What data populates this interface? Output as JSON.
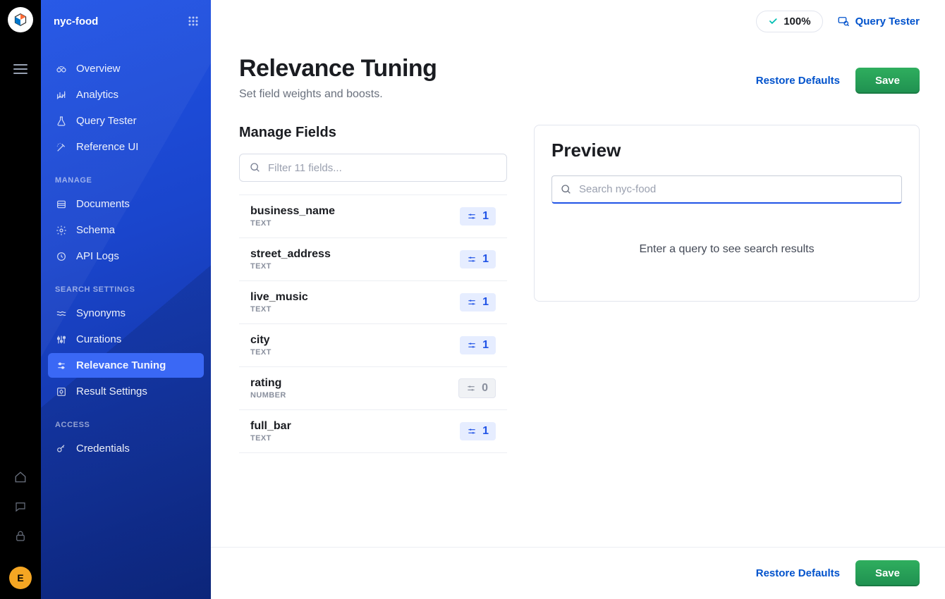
{
  "engine": {
    "name": "nyc-food"
  },
  "topbar": {
    "score_percent": "100%",
    "query_tester_label": "Query Tester"
  },
  "avatar": {
    "initial": "E"
  },
  "nav": {
    "top": [
      {
        "label": "Overview",
        "icon": "binoculars-icon"
      },
      {
        "label": "Analytics",
        "icon": "bars-trend-icon"
      },
      {
        "label": "Query Tester",
        "icon": "flask-icon"
      },
      {
        "label": "Reference UI",
        "icon": "magic-wand-icon"
      }
    ],
    "sections": [
      {
        "label": "MANAGE",
        "items": [
          {
            "label": "Documents",
            "icon": "list-icon"
          },
          {
            "label": "Schema",
            "icon": "gear-icon"
          },
          {
            "label": "API Logs",
            "icon": "clock-icon"
          }
        ]
      },
      {
        "label": "SEARCH SETTINGS",
        "items": [
          {
            "label": "Synonyms",
            "icon": "waves-icon"
          },
          {
            "label": "Curations",
            "icon": "levels-icon"
          },
          {
            "label": "Relevance Tuning",
            "icon": "sliders-icon",
            "active": true
          },
          {
            "label": "Result Settings",
            "icon": "settings-page-icon"
          }
        ]
      },
      {
        "label": "ACCESS",
        "items": [
          {
            "label": "Credentials",
            "icon": "key-icon"
          }
        ]
      }
    ]
  },
  "page": {
    "title": "Relevance Tuning",
    "subtitle": "Set field weights and boosts.",
    "restore_label": "Restore Defaults",
    "save_label": "Save"
  },
  "manage_fields": {
    "title": "Manage Fields",
    "filter_placeholder": "Filter 11 fields...",
    "fields": [
      {
        "name": "business_name",
        "type": "TEXT",
        "weight": "1",
        "muted": false
      },
      {
        "name": "street_address",
        "type": "TEXT",
        "weight": "1",
        "muted": false
      },
      {
        "name": "live_music",
        "type": "TEXT",
        "weight": "1",
        "muted": false
      },
      {
        "name": "city",
        "type": "TEXT",
        "weight": "1",
        "muted": false
      },
      {
        "name": "rating",
        "type": "NUMBER",
        "weight": "0",
        "muted": true
      },
      {
        "name": "full_bar",
        "type": "TEXT",
        "weight": "1",
        "muted": false
      }
    ]
  },
  "preview": {
    "title": "Preview",
    "search_placeholder": "Search nyc-food",
    "empty_text": "Enter a query to see search results"
  },
  "footer": {
    "restore_label": "Restore Defaults",
    "save_label": "Save"
  }
}
